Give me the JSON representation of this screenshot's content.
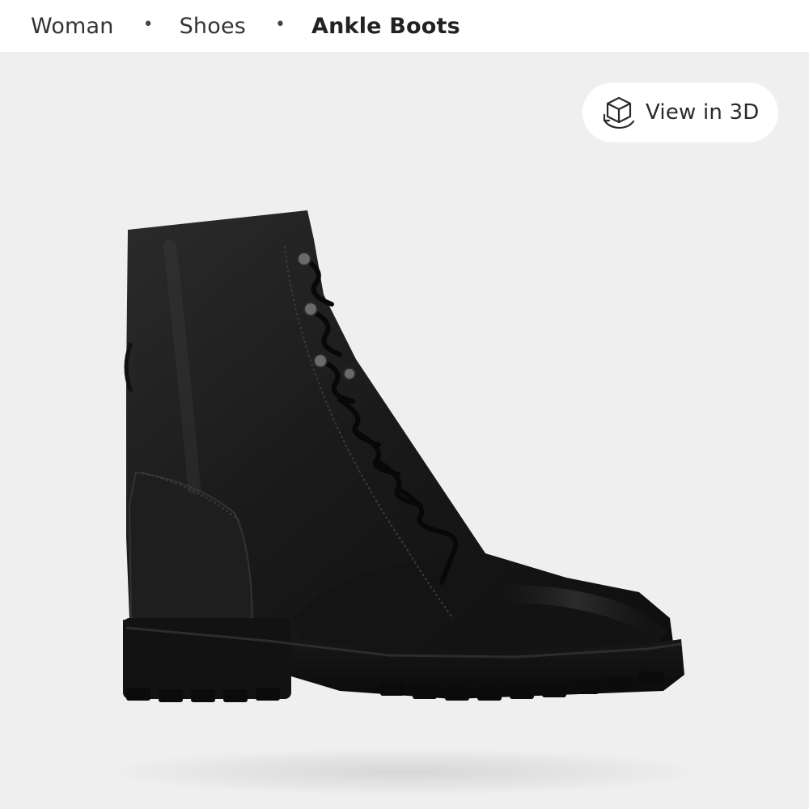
{
  "breadcrumb": {
    "items": [
      {
        "label": "Woman"
      },
      {
        "label": "Shoes"
      },
      {
        "label": "Ankle Boots"
      }
    ],
    "separator": "•"
  },
  "gallery": {
    "view_3d_label": "View in 3D",
    "view_3d_icon": "cube-rotate-icon",
    "product_image_subject": "black leather lace-up ankle boot",
    "background_color": "#efefef"
  }
}
